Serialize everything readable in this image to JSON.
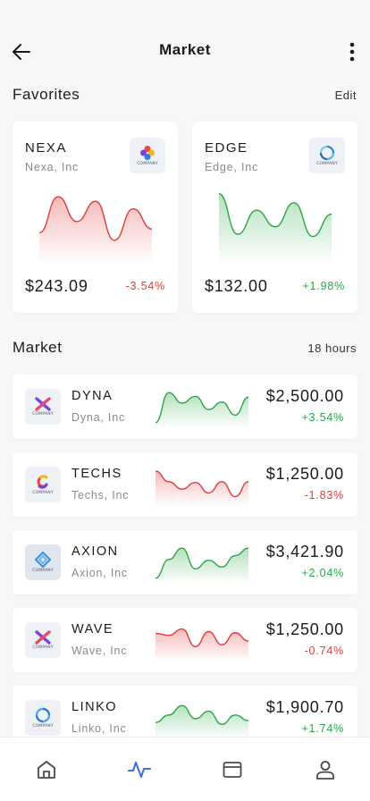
{
  "header": {
    "title": "Market",
    "back_icon": "arrow-left-icon",
    "more_icon": "more-vertical-icon"
  },
  "favorites": {
    "title": "Favorites",
    "edit_label": "Edit",
    "cards": [
      {
        "symbol": "NEXA",
        "name": "Nexa, Inc",
        "price": "$243.09",
        "change": "-3.54%",
        "trend": "down",
        "spark": [
          40,
          88,
          55,
          82,
          30,
          72,
          45
        ]
      },
      {
        "symbol": "EDGE",
        "name": "Edge, Inc",
        "price": "$132.00",
        "change": "+1.98%",
        "trend": "up",
        "spark": [
          92,
          38,
          70,
          48,
          80,
          35,
          65
        ]
      }
    ]
  },
  "market": {
    "title": "Market",
    "period_label": "18 hours",
    "rows": [
      {
        "symbol": "DYNA",
        "name": "Dyna, Inc",
        "price": "$2,500.00",
        "change": "+3.54%",
        "trend": "up",
        "spark": [
          10,
          90,
          62,
          80,
          45,
          65,
          30,
          78
        ]
      },
      {
        "symbol": "TECHS",
        "name": "Techs, Inc",
        "price": "$1,250.00",
        "change": "-1.83%",
        "trend": "down",
        "spark": [
          88,
          60,
          40,
          58,
          30,
          60,
          20,
          60
        ]
      },
      {
        "symbol": "AXION",
        "name": "Axion, Inc",
        "price": "$3,421.90",
        "change": "+2.04%",
        "trend": "up",
        "spark": [
          10,
          60,
          90,
          35,
          58,
          40,
          70,
          90
        ]
      },
      {
        "symbol": "WAVE",
        "name": "Wave, Inc",
        "price": "$1,250.00",
        "change": "-0.74%",
        "trend": "down",
        "spark": [
          70,
          65,
          82,
          35,
          75,
          40,
          72,
          50
        ]
      },
      {
        "symbol": "LINKO",
        "name": "Linko, Inc",
        "price": "$1,900.70",
        "change": "+1.74%",
        "trend": "up",
        "spark": [
          40,
          60,
          85,
          50,
          70,
          35,
          60,
          45
        ]
      }
    ]
  },
  "logo_caption": "COMPANY",
  "nav": [
    {
      "icon": "home-icon",
      "active": false
    },
    {
      "icon": "activity-icon",
      "active": true
    },
    {
      "icon": "wallet-card-icon",
      "active": false
    },
    {
      "icon": "user-icon",
      "active": false
    }
  ],
  "colors": {
    "up": "#28a745",
    "down": "#e23b3b",
    "active_nav": "#3b6fe0",
    "nav": "#4a4a4a"
  }
}
